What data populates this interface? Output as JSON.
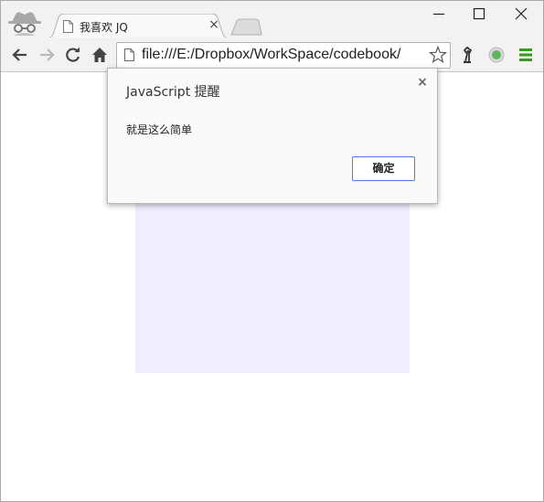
{
  "browser": {
    "tab": {
      "title": "我喜欢 JQ",
      "close": "×",
      "icon": "page-icon"
    },
    "new_tab_icon": "new-tab-icon",
    "window_controls": [
      "minimize-icon",
      "maximize-icon",
      "close-icon"
    ],
    "toolbar": {
      "buttons": [
        "back-icon",
        "forward-icon",
        "reload-icon",
        "home-icon"
      ],
      "url": "file:///E:/Dropbox/WorkSpace/codebook/",
      "extensions": [
        "bookmark-star-icon",
        "extension-icon",
        "status-dot-icon",
        "menu-icon"
      ]
    }
  },
  "dialog": {
    "title": "JavaScript 提醒",
    "close": "×",
    "message": "就是这么简单",
    "ok_label": "确定"
  },
  "colors": {
    "box_fill": "#eeeeff",
    "dialog_button_border": "#4a7fd9",
    "menu_icon": "#3a9a1e",
    "status_dot": "#5cb85c"
  }
}
